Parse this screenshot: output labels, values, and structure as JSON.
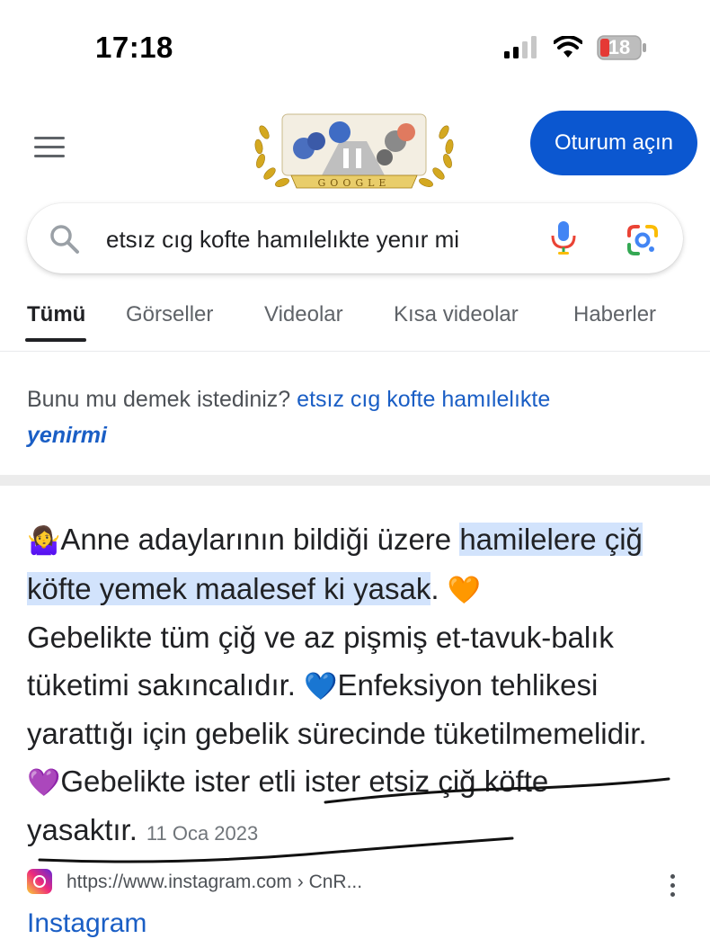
{
  "status_bar": {
    "time": "17:18",
    "battery": "18"
  },
  "header": {
    "doodle_text": "GOOGLE",
    "signin_label": "Oturum açın"
  },
  "search": {
    "query": "etsız cıg kofte hamılelıkte yenır mi"
  },
  "tabs": [
    {
      "label": "Tümü",
      "active": true
    },
    {
      "label": "Görseller"
    },
    {
      "label": "Videolar"
    },
    {
      "label": "Kısa videolar"
    },
    {
      "label": "Haberler"
    }
  ],
  "suggestion": {
    "prefix": "Bunu mu demek istediniz?",
    "link_normal": "etsız cıg kofte hamılelıkte",
    "link_bold": "yenirmi"
  },
  "snippet": {
    "emoji_start": "🤷‍♀️",
    "text_before": "Anne adaylarının bildiği üzere ",
    "highlight": "hamilelere çiğ köfte yemek maalesef ki yasak",
    "after_highlight": ".",
    "emoji_orange": "🧡",
    "sentence2": "Gebelikte tüm çiğ ve az pişmiş et-tavuk-balık tüketimi sakıncalıdır.",
    "emoji_blue": "💙",
    "sentence3": "Enfeksiyon tehlikesi yarattığı için gebelik sürecinde tüketilmemelidir.",
    "emoji_purple": "💜",
    "sentence4": "Gebelikte ister etli ister etsiz çiğ köfte yasaktır.",
    "date": "11 Oca 2023"
  },
  "source": {
    "url": "https://www.instagram.com › CnR...",
    "next_title": "Instagram"
  },
  "colors": {
    "accent": "#0b57d0",
    "link": "#1a5ec5",
    "highlight": "#d2e3fc"
  }
}
